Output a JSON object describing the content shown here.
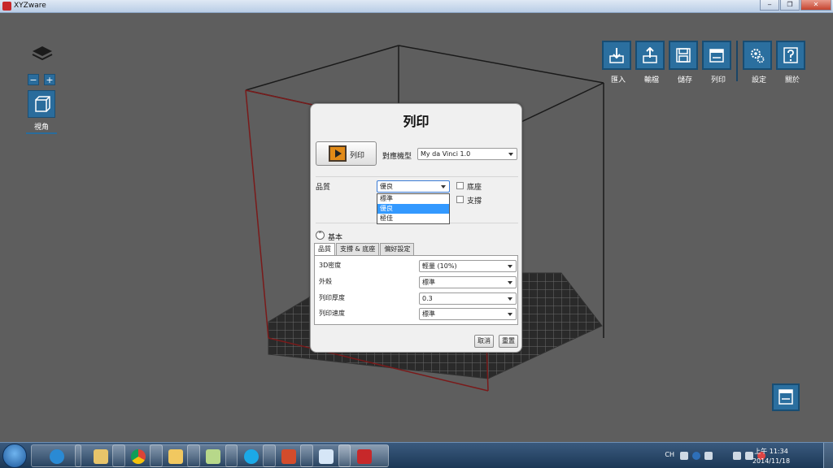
{
  "window": {
    "title": "XYZware"
  },
  "view_controls": {
    "view_label": "視角"
  },
  "toolbar": {
    "import": "匯入",
    "export": "輸檔",
    "save": "儲存",
    "print": "列印",
    "settings": "設定",
    "about": "關於"
  },
  "dialog": {
    "title": "列印",
    "print_button": "列印",
    "model_label": "對應機型",
    "model_value": "My da Vinci 1.0",
    "quality_label": "品質",
    "quality_value": "優良",
    "quality_options": [
      "標準",
      "優良",
      "極佳"
    ],
    "raft_label": "底座",
    "support_label": "支撐",
    "basic_label": "基本",
    "tabs": [
      "品質",
      "支撐 & 底座",
      "偏好設定"
    ],
    "rows": [
      {
        "label": "3D密度",
        "value": "輕量 (10%)"
      },
      {
        "label": "外殼",
        "value": "標準"
      },
      {
        "label": "列印厚度",
        "value": "0.3"
      },
      {
        "label": "列印速度",
        "value": "標準"
      }
    ],
    "cancel": "取消",
    "reset": "重置"
  },
  "taskbar": {
    "lang": "CH",
    "time": "上午 11:34",
    "date": "2014/11/18"
  }
}
